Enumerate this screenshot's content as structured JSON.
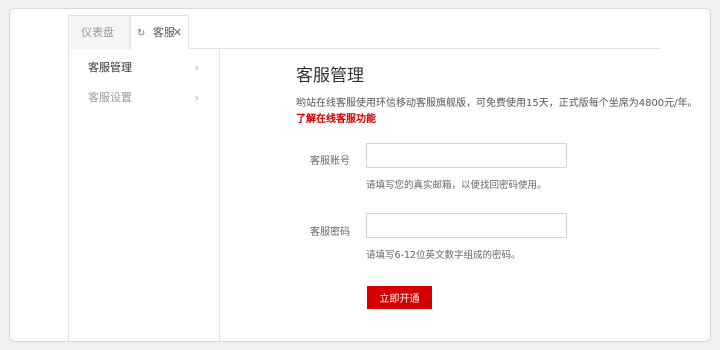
{
  "tabs": [
    {
      "label": "仪表盘"
    },
    {
      "label": "客服",
      "refresh_icon": "refresh-icon",
      "close_icon": "close-icon"
    }
  ],
  "sidebar": {
    "items": [
      {
        "label": "客服管理",
        "active": true
      },
      {
        "label": "客服设置",
        "active": false
      }
    ]
  },
  "main": {
    "title": "客服管理",
    "description": "哟站在线客服使用环信移动客服旗舰版，可免费使用15天，正式版每个坐席为4800元/年。",
    "learn_more": "了解在线客服功能",
    "account": {
      "label": "客服账号",
      "value": "",
      "placeholder": "",
      "hint": "请填写您的真实邮箱，以便找回密码使用。"
    },
    "password": {
      "label": "客服密码",
      "value": "",
      "placeholder": "",
      "hint": "请填写6-12位英文数字组成的密码。"
    },
    "submit_label": "立即开通"
  },
  "colors": {
    "accent": "#d40000",
    "background": "#eef0f2"
  }
}
